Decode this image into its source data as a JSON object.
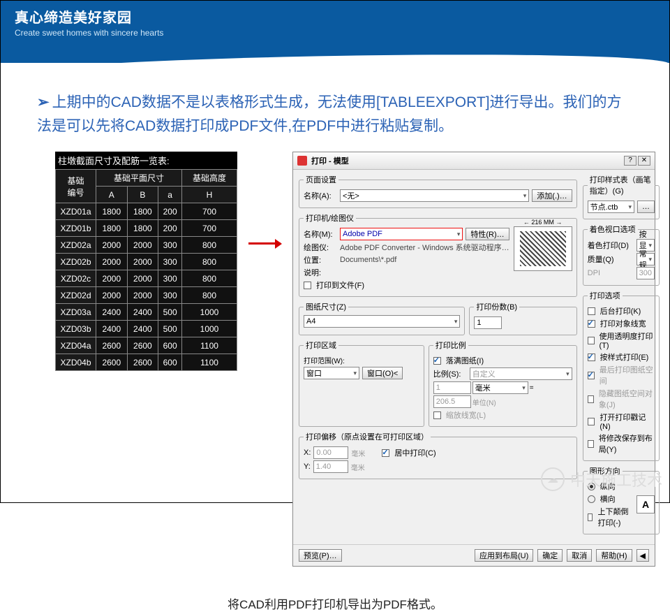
{
  "banner": {
    "cn": "真心缔造美好家园",
    "en": "Create sweet homes with sincere hearts"
  },
  "note": "上期中的CAD数据不是以表格形式生成，无法使用[TABLEEXPORT]进行导出。我们的方法是可以先将CAD数据打印成PDF文件,在PDF中进行粘贴复制。",
  "cad": {
    "title": "柱墩截面尺寸及配筋一览表:",
    "h1": {
      "c0": "基础\n编号",
      "c1": "基础平面尺寸",
      "c2": "基础高度"
    },
    "h2": {
      "a": "A",
      "b": "B",
      "h": "a",
      "H": "H"
    },
    "rows": [
      {
        "id": "XZD01a",
        "A": "1800",
        "B": "1800",
        "a": "200",
        "H": "700"
      },
      {
        "id": "XZD01b",
        "A": "1800",
        "B": "1800",
        "a": "200",
        "H": "700"
      },
      {
        "id": "XZD02a",
        "A": "2000",
        "B": "2000",
        "a": "300",
        "H": "800"
      },
      {
        "id": "XZD02b",
        "A": "2000",
        "B": "2000",
        "a": "300",
        "H": "800"
      },
      {
        "id": "XZD02c",
        "A": "2000",
        "B": "2000",
        "a": "300",
        "H": "800"
      },
      {
        "id": "XZD02d",
        "A": "2000",
        "B": "2000",
        "a": "300",
        "H": "800"
      },
      {
        "id": "XZD03a",
        "A": "2400",
        "B": "2400",
        "a": "500",
        "H": "1000"
      },
      {
        "id": "XZD03b",
        "A": "2400",
        "B": "2400",
        "a": "500",
        "H": "1000"
      },
      {
        "id": "XZD04a",
        "A": "2600",
        "B": "2600",
        "a": "600",
        "H": "1100"
      },
      {
        "id": "XZD04b",
        "A": "2600",
        "B": "2600",
        "a": "600",
        "H": "1100"
      }
    ]
  },
  "dlg": {
    "title": "打印 - 模型",
    "page_setup": {
      "legend": "页面设置",
      "name_l": "名称(A):",
      "name_v": "<无>",
      "add_btn": "添加(.)…"
    },
    "printer": {
      "legend": "打印机/绘图仪",
      "name_l": "名称(M):",
      "name_v": "Adobe PDF",
      "prop_btn": "特性(R)…",
      "plotter_l": "绘图仪:",
      "plotter_v": "Adobe PDF Converter - Windows 系统驱动程序…",
      "loc_l": "位置:",
      "loc_v": "Documents\\*.pdf",
      "desc_l": "说明:",
      "tofile_chk": "打印到文件(F)",
      "preview_dim": "← 216 MM →"
    },
    "paper": {
      "legend": "图纸尺寸(Z)",
      "value": "A4"
    },
    "copies": {
      "label": "打印份数(B)",
      "value": "1"
    },
    "area": {
      "legend": "打印区域",
      "range_l": "打印范围(W):",
      "range_v": "窗口",
      "win_btn": "窗口(O)<"
    },
    "scale": {
      "legend": "打印比例",
      "fit_chk": "落满图纸(I)",
      "ratio_l": "比例(S):",
      "ratio_v": "自定义",
      "num": "1",
      "unit": "毫米",
      "den": "206.5",
      "den_unit": "单位(N)",
      "lw_chk": "缩放线宽(L)"
    },
    "offset": {
      "legend": "打印偏移（原点设置在可打印区域）",
      "x_l": "X:",
      "x_v": "0.00",
      "y_l": "Y:",
      "y_v": "1.40",
      "unit": "毫米",
      "center_chk": "居中打印(C)"
    },
    "style": {
      "legend": "打印样式表（画笔指定）(G)",
      "value": "节点.ctb",
      "edit_btn": "…"
    },
    "viewport": {
      "legend": "着色视口选项",
      "shade_l": "着色打印(D)",
      "shade_v": "按显示",
      "q_l": "质量(Q)",
      "q_v": "常规",
      "dpi_l": "DPI",
      "dpi_v": "300"
    },
    "options": {
      "legend": "打印选项",
      "o1": "后台打印(K)",
      "o2": "打印对象线宽",
      "o3": "使用透明度打印(T)",
      "o4": "按样式打印(E)",
      "o5": "最后打印图纸空间",
      "o6": "隐藏图纸空间对象(J)",
      "o7": "打开打印戳记(N)",
      "o8": "将修改保存到布局(Y)"
    },
    "orient": {
      "legend": "图形方向",
      "portrait": "纵向",
      "landscape": "横向",
      "upside": "上下颠倒打印(-)"
    },
    "footer": {
      "preview": "预览(P)…",
      "apply": "应用到布局(U)",
      "ok": "确定",
      "cancel": "取消",
      "help": "帮助(H)"
    }
  },
  "caption": "将CAD利用PDF打印机导出为PDF格式。",
  "watermark": "中天施工技术"
}
